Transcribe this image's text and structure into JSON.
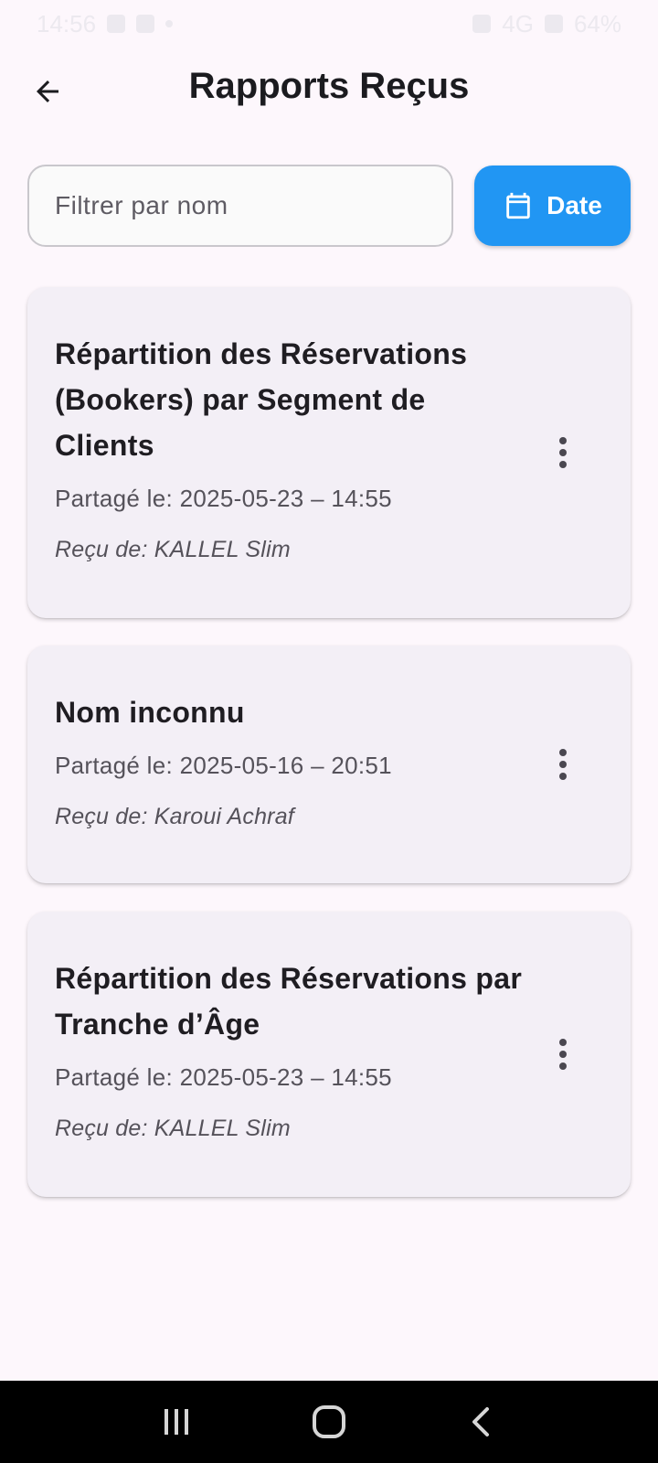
{
  "status_bar": {
    "time": "14:56",
    "network": "4G",
    "battery": "64%"
  },
  "header": {
    "title": "Rapports Reçus",
    "back_icon": "arrow-left-icon"
  },
  "filter": {
    "placeholder": "Filtrer par nom",
    "value": "",
    "date_button_label": "Date",
    "date_button_icon": "calendar-icon",
    "accent_color": "#2196f3"
  },
  "reports": [
    {
      "title": "Répartition des Réservations (Bookers) par Segment de Clients",
      "shared": "Partagé le: 2025-05-23 – 14:55",
      "from": "Reçu de: KALLEL Slim"
    },
    {
      "title": "Nom inconnu",
      "shared": "Partagé le: 2025-05-16 – 20:51",
      "from": "Reçu de: Karoui Achraf"
    },
    {
      "title": "Répartition des Réservations par Tranche d’Âge",
      "shared": "Partagé le: 2025-05-23 – 14:55",
      "from": "Reçu de: KALLEL Slim"
    }
  ],
  "nav": {
    "recents_icon": "recents-icon",
    "home_icon": "home-icon",
    "back_icon": "back-icon"
  }
}
